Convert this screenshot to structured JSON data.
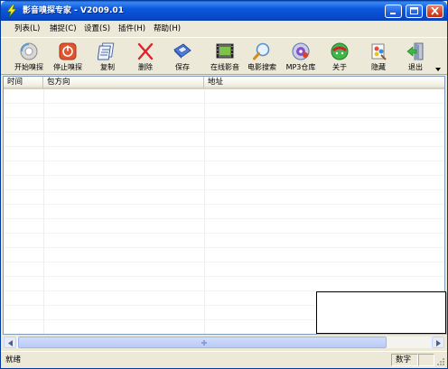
{
  "window": {
    "title": "影音嗅探专家 - V2009.01"
  },
  "menu": [
    {
      "label": "列表(L)"
    },
    {
      "label": "捕捉(C)"
    },
    {
      "label": "设置(S)"
    },
    {
      "label": "插件(H)"
    },
    {
      "label": "帮助(H)"
    }
  ],
  "toolbar": {
    "items": [
      {
        "label": "开始嗅探",
        "icon": "start-sniff-icon"
      },
      {
        "label": "停止嗅探",
        "icon": "stop-sniff-icon"
      },
      {
        "label": "复制",
        "icon": "copy-icon"
      },
      {
        "label": "删除",
        "icon": "delete-icon"
      },
      {
        "label": "保存",
        "icon": "save-disk-icon"
      },
      {
        "label": "在线影音",
        "icon": "online-video-icon"
      },
      {
        "label": "电影搜索",
        "icon": "movie-search-icon"
      },
      {
        "label": "MP3仓库",
        "icon": "mp3-warehouse-icon"
      },
      {
        "label": "关于",
        "icon": "about-icon"
      },
      {
        "label": "隐藏",
        "icon": "hide-icon"
      },
      {
        "label": "退出",
        "icon": "exit-icon"
      }
    ]
  },
  "list": {
    "columns": [
      {
        "label": "时间"
      },
      {
        "label": "包方向"
      },
      {
        "label": "地址"
      }
    ],
    "rows": []
  },
  "status": {
    "text": "就绪",
    "panel_label": "数字"
  },
  "colors": {
    "titlebar": "#0a58df",
    "stop_button": "#e0552e",
    "delete_x": "#e0202a"
  }
}
